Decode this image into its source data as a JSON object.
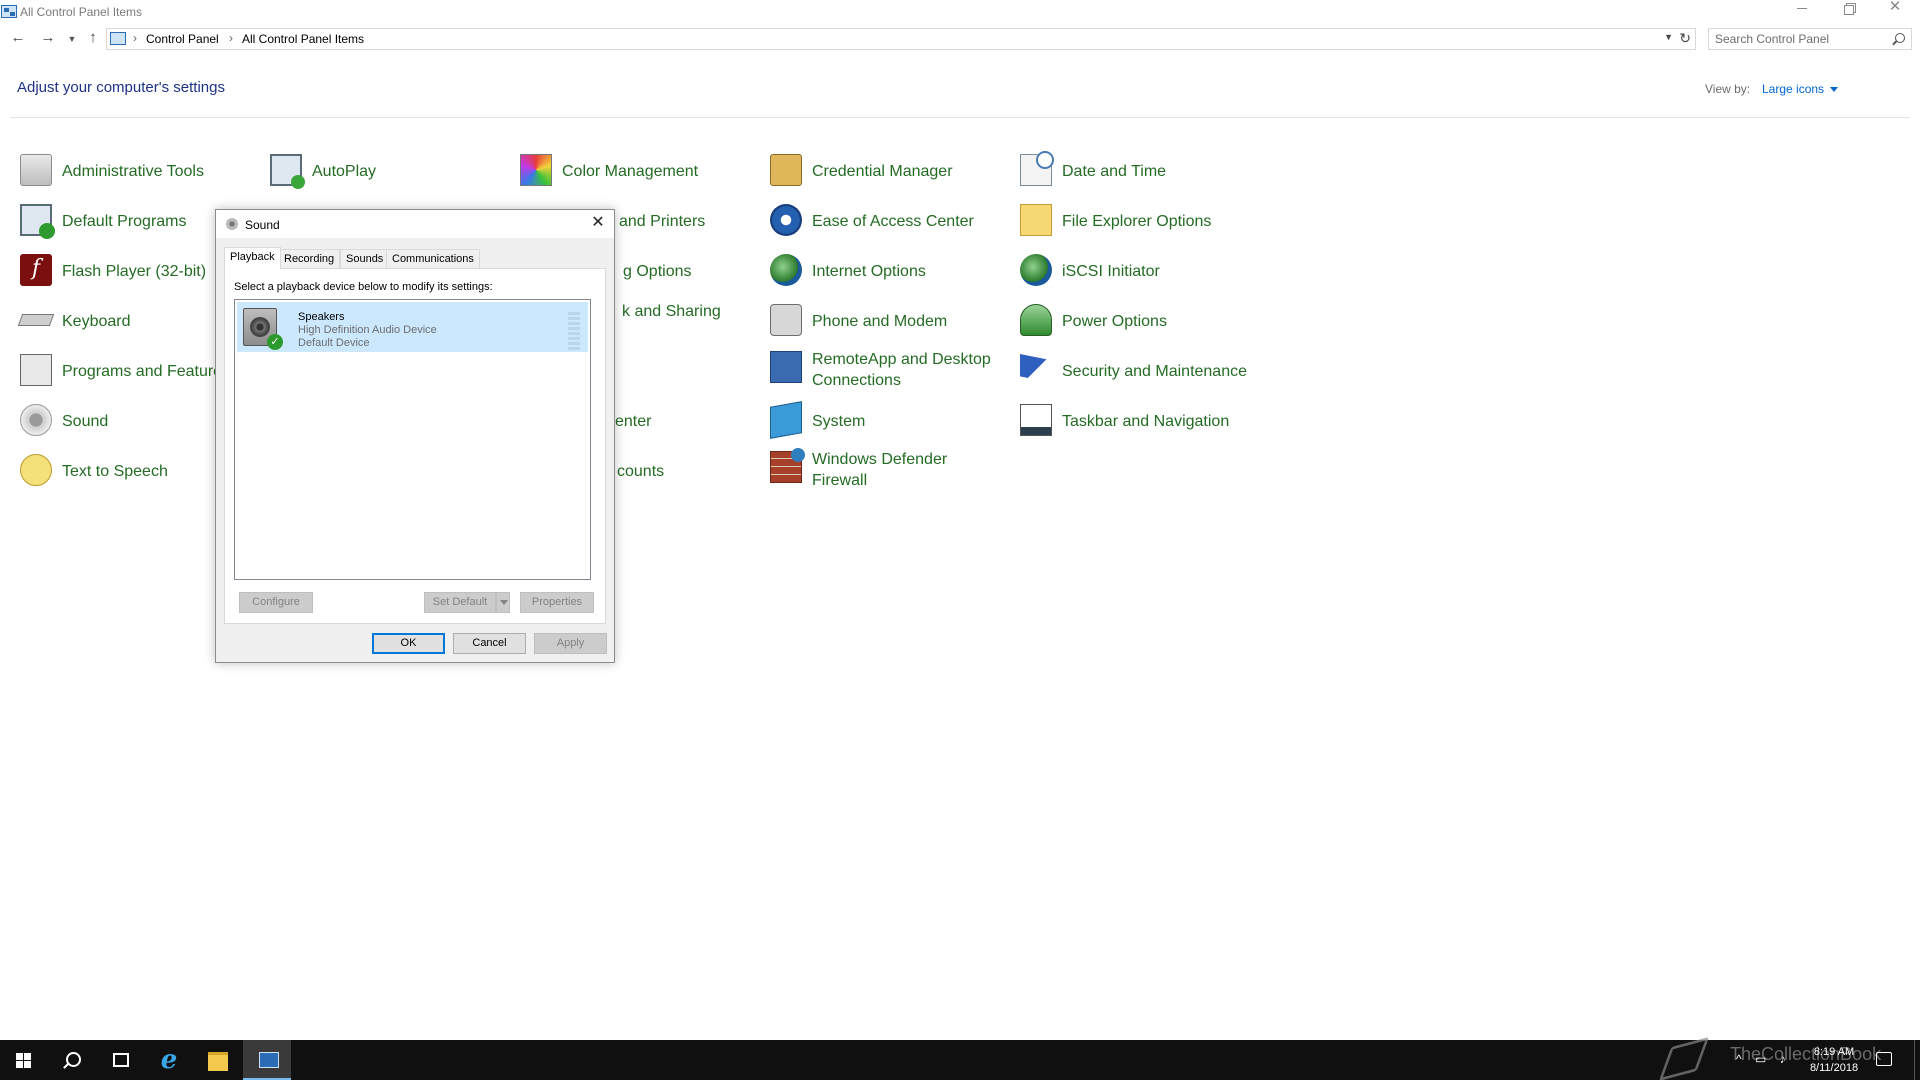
{
  "window": {
    "title": "All Control Panel Items"
  },
  "nav": {
    "breadcrumb": [
      "Control Panel",
      "All Control Panel Items"
    ],
    "search_placeholder": "Search Control Panel"
  },
  "header": {
    "title": "Adjust your computer's settings",
    "view_by_label": "View by:",
    "view_by_value": "Large icons"
  },
  "items": [
    {
      "label": "Administrative Tools",
      "icon": "admin-tools-icon"
    },
    {
      "label": "AutoPlay",
      "icon": "autoplay-icon"
    },
    {
      "label": "Color Management",
      "icon": "color-management-icon"
    },
    {
      "label": "Credential Manager",
      "icon": "credential-manager-icon"
    },
    {
      "label": "Date and Time",
      "icon": "date-time-icon"
    },
    {
      "label": "Default Programs",
      "icon": "default-programs-icon"
    },
    {
      "label": "and Printers",
      "icon": "devices-printers-icon"
    },
    {
      "label": "Ease of Access Center",
      "icon": "ease-of-access-icon"
    },
    {
      "label": "File Explorer Options",
      "icon": "file-explorer-options-icon"
    },
    {
      "label": "Flash Player (32-bit)",
      "icon": "flash-player-icon"
    },
    {
      "label": "g Options",
      "icon": "indexing-options-icon"
    },
    {
      "label": "Internet Options",
      "icon": "internet-options-icon"
    },
    {
      "label": "iSCSI Initiator",
      "icon": "iscsi-initiator-icon"
    },
    {
      "label": "Keyboard",
      "icon": "keyboard-icon"
    },
    {
      "label": "k and Sharing",
      "icon": "network-sharing-icon"
    },
    {
      "label": "Phone and Modem",
      "icon": "phone-modem-icon"
    },
    {
      "label": "Power Options",
      "icon": "power-options-icon"
    },
    {
      "label": "Programs and Feature",
      "icon": "programs-features-icon"
    },
    {
      "label": "RemoteApp and Desktop Connections",
      "icon": "remoteapp-icon"
    },
    {
      "label": "Security and Maintenance",
      "icon": "security-maintenance-icon"
    },
    {
      "label": "Sound",
      "icon": "sound-icon"
    },
    {
      "label": "enter",
      "icon": "sync-center-icon"
    },
    {
      "label": "System",
      "icon": "system-icon"
    },
    {
      "label": "Taskbar and Navigation",
      "icon": "taskbar-navigation-icon"
    },
    {
      "label": "Text to Speech",
      "icon": "text-to-speech-icon"
    },
    {
      "label": "counts",
      "icon": "user-accounts-icon"
    },
    {
      "label": "Windows Defender Firewall",
      "icon": "firewall-icon"
    }
  ],
  "dialog": {
    "title": "Sound",
    "tabs": [
      "Playback",
      "Recording",
      "Sounds",
      "Communications"
    ],
    "active_tab": "Playback",
    "instruction": "Select a playback device below to modify its settings:",
    "device": {
      "name": "Speakers",
      "description": "High Definition Audio Device",
      "status": "Default Device"
    },
    "buttons": {
      "configure": "Configure",
      "set_default": "Set Default",
      "properties": "Properties",
      "ok": "OK",
      "cancel": "Cancel",
      "apply": "Apply"
    }
  },
  "taskbar": {
    "watermark": "TheCollectionBook",
    "time": "8:19 AM",
    "date": "8/11/2018"
  },
  "colors": {
    "link_green": "#246b24",
    "title_blue": "#1e3287",
    "accent": "#0078d7",
    "taskbar": "#101010"
  }
}
